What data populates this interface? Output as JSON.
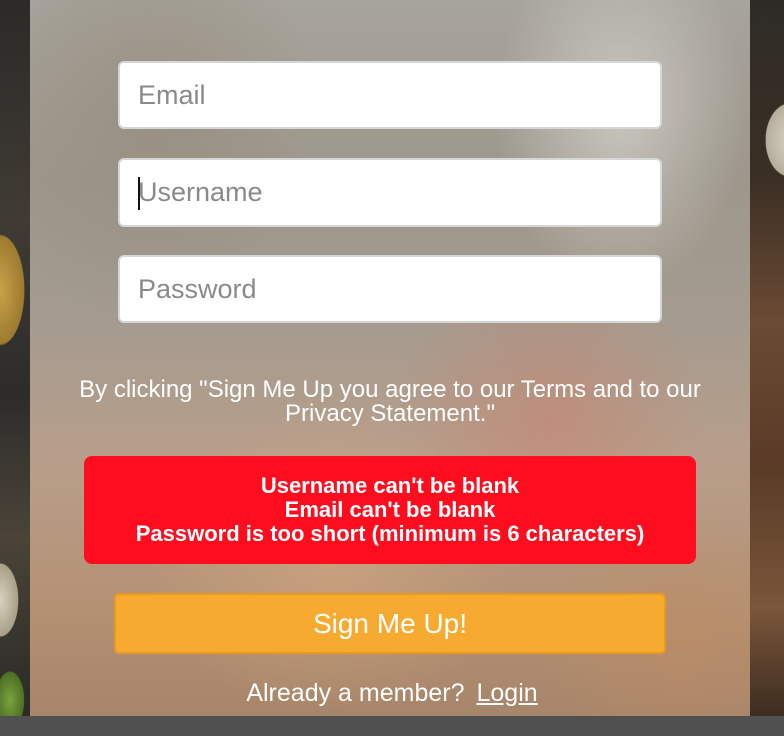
{
  "form": {
    "email_placeholder": "Email",
    "email_value": "",
    "username_placeholder": "Username",
    "username_value": "",
    "password_placeholder": "Password",
    "password_value": ""
  },
  "terms_text": "By clicking \"Sign Me Up you agree to our Terms and to our Privacy Statement.\"",
  "errors": [
    "Username can't be blank",
    "Email can't be blank",
    "Password is too short (minimum is 6 characters)"
  ],
  "signup_button_label": "Sign Me Up!",
  "member_prompt": "Already a member?",
  "login_link_label": "Login",
  "colors": {
    "error_background": "#ff0c1e",
    "button_background": "#f6aa2f",
    "text_light": "#ffffff"
  }
}
